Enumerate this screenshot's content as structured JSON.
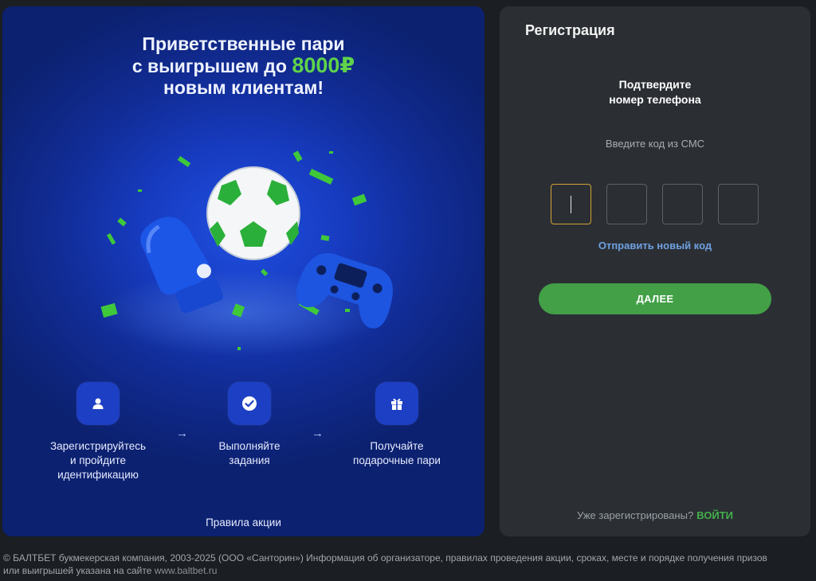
{
  "promo": {
    "title_line1": "Приветственные пари",
    "title_line2_prefix": "с выигрышем до ",
    "title_amount": "8000₽",
    "title_line3": "новым клиентам!",
    "steps": [
      {
        "line1": "Зарегистрируйтесь",
        "line2": "и пройдите",
        "line3": "идентификацию",
        "icon": "user-icon"
      },
      {
        "line1": "Выполняйте",
        "line2": "задания",
        "icon": "check-circle-icon"
      },
      {
        "line1": "Получайте",
        "line2": "подарочные пари",
        "icon": "gift-icon"
      }
    ],
    "arrow": "→",
    "rules_link": "Правила акции",
    "colors": {
      "accent": "#5fd34a",
      "background": "#1434a8"
    }
  },
  "registration": {
    "title": "Регистрация",
    "confirm_line1": "Подтвердите",
    "confirm_line2": "номер телефона",
    "sms_hint": "Введите код из СМС",
    "code_length": 4,
    "resend_link": "Отправить новый код",
    "next_button": "ДАЛЕЕ",
    "already_registered": "Уже зарегистрированы?",
    "login_link": "ВОЙТИ",
    "colors": {
      "button": "#43a047",
      "link": "#6fa0e0",
      "active_border": "#d3a236"
    }
  },
  "footer": {
    "line1": "© БАЛТБЕТ букмекерская компания, 2003-2025 (ООО «Санторин») Информация об организаторе, правилах проведения акции, сроках, месте и порядке получения призов",
    "line2_prefix": "или выигрышей указана на сайте ",
    "site": "www.baltbet.ru"
  }
}
